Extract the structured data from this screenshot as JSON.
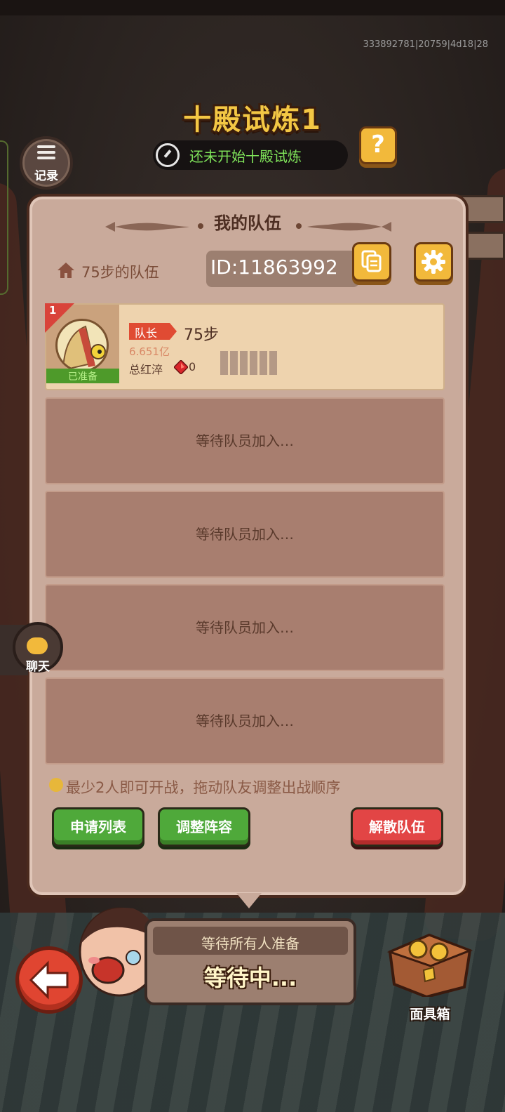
{
  "debug_info": "333892781|20759|4d18|28",
  "header": {
    "title": "十殿试炼1",
    "status": "还未开始十殿试炼",
    "help_label": "?",
    "record_label": "记录"
  },
  "panel": {
    "title": "我的队伍",
    "team_name": "75步的队伍",
    "team_id": "ID:11863992"
  },
  "members": [
    {
      "rank": "1",
      "ready": "已准备",
      "role": "队长",
      "name": "75步",
      "power": "6.651亿",
      "total_label": "总红淬",
      "gem_count": "0"
    }
  ],
  "empty_slots": [
    "等待队员加入…",
    "等待队员加入…",
    "等待队员加入…",
    "等待队员加入…"
  ],
  "hint": "最少2人即可开战，拖动队友调整出战顺序",
  "buttons": {
    "apply_list": "申请列表",
    "adjust_lineup": "调整阵容",
    "dismiss_team": "解散队伍"
  },
  "bottom": {
    "chat_label": "聊天",
    "wait_label": "等待所有人准备",
    "wait_status": "等待中...",
    "chest_label": "面具箱"
  },
  "colors": {
    "title_gold": "#f3c744",
    "status_green": "#7fe35a",
    "button_green": "#4fa93a",
    "button_red": "#e24545",
    "panel_bg": "#c9aa9b",
    "button_yellow": "#f2b93b"
  },
  "icons": {
    "record": "list-icon",
    "status": "clock-icon",
    "help": "question-icon",
    "home": "home-icon",
    "copy": "copy-icon",
    "settings": "gear-icon",
    "gem": "red-gem-icon",
    "chat": "chat-bubble-icon",
    "back": "back-arrow-icon",
    "chest": "mask-chest-icon"
  }
}
